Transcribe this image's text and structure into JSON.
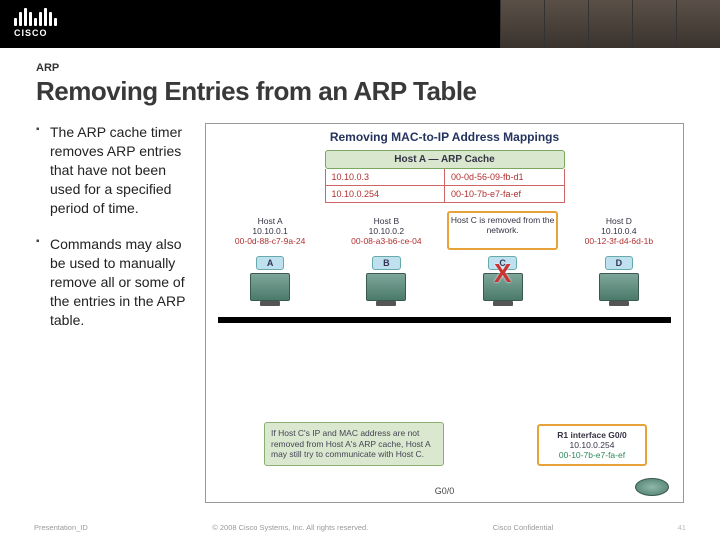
{
  "header": {
    "logo_text": "CISCO"
  },
  "slide": {
    "eyebrow": "ARP",
    "title": "Removing Entries from an ARP Table",
    "bullets": [
      "The ARP cache timer removes ARP entries that have not been used for a specified period of time.",
      "Commands may also be used to manually remove all or some of the entries in the ARP table."
    ]
  },
  "diagram": {
    "title": "Removing MAC-to-IP Address Mappings",
    "cache": {
      "header": "Host A — ARP Cache",
      "rows": [
        {
          "ip": "10.10.0.3",
          "mac": "00-0d-56-09-fb-d1"
        },
        {
          "ip": "10.10.0.254",
          "mac": "00-10-7b-e7-fa-ef"
        }
      ]
    },
    "hosts": [
      {
        "name": "Host A",
        "ip": "10.10.0.1",
        "mac": "00-0d-88-c7-9a-24",
        "removed": false
      },
      {
        "name": "Host B",
        "ip": "10.10.0.2",
        "mac": "00-08-a3-b6-ce-04",
        "removed": false
      },
      {
        "msg": "Host C is removed from the network.",
        "removed": true
      },
      {
        "name": "Host D",
        "ip": "10.10.0.4",
        "mac": "00-12-3f-d4-6d-1b",
        "removed": false
      }
    ],
    "pc_labels": [
      "A",
      "B",
      "C",
      "D"
    ],
    "x_mark": "X",
    "note": "If Host C's IP and MAC address are not removed from Host A's ARP cache, Host A may still try to communicate with Host C.",
    "router": {
      "name": "R1 interface G0/0",
      "ip": "10.10.0.254",
      "mac": "00-10-7b-e7-fa-ef"
    },
    "port_label": "G0/0"
  },
  "footer": {
    "left": "Presentation_ID",
    "center": "© 2008 Cisco Systems, Inc. All rights reserved.",
    "right": "Cisco Confidential",
    "page": "41"
  }
}
